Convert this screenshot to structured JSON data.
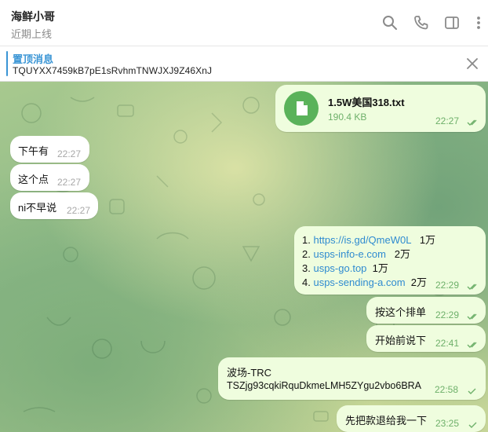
{
  "header": {
    "title": "海鲜小哥",
    "subtitle": "近期上线"
  },
  "pinned": {
    "title": "置顶消息",
    "text": "TQUYXX7459kB7pE1sRvhmTNWJXJ9Z46XnJ"
  },
  "messages": {
    "file": {
      "name": "1.5W美国318.txt",
      "size": "190.4 KB",
      "time": "22:27"
    },
    "in1": {
      "text": "下午有",
      "time": "22:27"
    },
    "in2": {
      "text": "这个点",
      "time": "22:27"
    },
    "in3": {
      "text": "ni不早说",
      "time": "22:27"
    },
    "list": {
      "items": [
        {
          "num": "1.",
          "link": "https://is.gd/QmeW0L",
          "note": "1万"
        },
        {
          "num": "2.",
          "link": "usps-info-e.com",
          "note": "2万"
        },
        {
          "num": "3.",
          "link": "usps-go.top",
          "note": "1万"
        },
        {
          "num": "4.",
          "link": "usps-sending-a.com",
          "note": "2万"
        }
      ],
      "time": "22:29"
    },
    "out2": {
      "text": "按这个排单",
      "time": "22:29"
    },
    "out3": {
      "text": "开始前说下",
      "time": "22:41"
    },
    "out4": {
      "line1": "波场-TRC",
      "line2": "TSZjg93cqkiRquDkmeLMH5ZYgu2vbo6BRA",
      "time": "22:58"
    },
    "out5": {
      "text": "先把款退给我一下",
      "time": "23:25"
    }
  },
  "colors": {
    "accent": "#3a95d5",
    "outgoing_bubble": "#effdde",
    "check": "#6eb06a",
    "file_icon": "#5ab25a"
  }
}
